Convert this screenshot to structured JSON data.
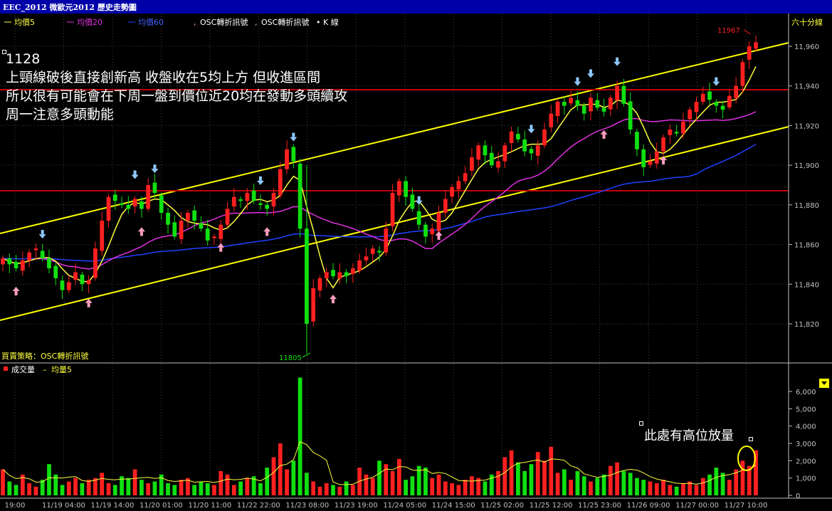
{
  "window": {
    "title": "EEC_2012 微歐元2012  歷史走勢圖"
  },
  "legend": {
    "ma5": "均價5",
    "ma20": "均價20",
    "ma60": "均價60",
    "osc1": "OSC轉折訊號",
    "osc2": "OSC轉折訊號",
    "kline": "K 線",
    "period": "六十分線",
    "strategy": "買賣策略：OSC轉折訊號",
    "volume": "成交量",
    "vol_ma": "均量5"
  },
  "annotations": {
    "date_label": "1128",
    "line1": "上頸線破後直接創新高 收盤收在5均上方 但收進區間",
    "line2": "所以很有可能會在下周一盤到價位近20均在發動多頭續攻",
    "line3": "周一注意多頭動能",
    "volume_note": "此處有高位放量",
    "high_label": "11967",
    "low_label": "11805"
  },
  "colors": {
    "up": "#ff2020",
    "down": "#10e010",
    "ma5": "#ffff40",
    "ma20": "#e030e0",
    "ma60": "#2040ff",
    "channel": "#ffff00",
    "neckline": "#c00000",
    "grid": "#404040",
    "buy_arrow": "#ff9ec0",
    "sell_arrow": "#8ec8ff"
  },
  "chart_data": [
    {
      "type": "candlestick",
      "title": "EEC_2012 微歐元2012 六十分線",
      "y_ticks": [
        "11,820",
        "11,840",
        "11,860",
        "11,880",
        "11,900",
        "11,920",
        "11,940",
        "11,960"
      ],
      "ylim": [
        11805,
        11975
      ],
      "x_ticks": [
        "19:00",
        "11/19 04:00",
        "11/19 14:00",
        "11/20 01:00",
        "11/20 11:00",
        "11/22 22:00",
        "11/23 08:00",
        "11/23 19:00",
        "11/24 05:00",
        "11/24 15:00",
        "11/25 02:00",
        "11/25 12:00",
        "11/25 23:00",
        "11/26 09:00",
        "11/27 00:00",
        "11/27 10:00"
      ],
      "close": [
        11853,
        11850,
        11848,
        11852,
        11856,
        11858,
        11853,
        11848,
        11843,
        11837,
        11841,
        11846,
        11840,
        11842,
        11858,
        11872,
        11884,
        11882,
        11880,
        11878,
        11883,
        11878,
        11890,
        11886,
        11876,
        11870,
        11864,
        11872,
        11876,
        11872,
        11868,
        11862,
        11864,
        11870,
        11878,
        11884,
        11882,
        11886,
        11882,
        11880,
        11878,
        11886,
        11898,
        11908,
        11902,
        11868,
        11820,
        11838,
        11843,
        11846,
        11844,
        11846,
        11844,
        11848,
        11852,
        11854,
        11858,
        11856,
        11868,
        11886,
        11892,
        11884,
        11878,
        11870,
        11864,
        11868,
        11876,
        11883,
        11889,
        11892,
        11896,
        11904,
        11910,
        11905,
        11900,
        11902,
        11910,
        11917,
        11913,
        11907,
        11906,
        11910,
        11918,
        11926,
        11932,
        11930,
        11934,
        11930,
        11926,
        11934,
        11929,
        11927,
        11934,
        11940,
        11931,
        11918,
        11908,
        11899,
        11902,
        11907,
        11914,
        11918,
        11916,
        11922,
        11928,
        11932,
        11936,
        11933,
        11930,
        11928,
        11935,
        11940,
        11952,
        11960,
        11962
      ],
      "volume": [
        1500,
        800,
        600,
        1200,
        700,
        500,
        900,
        1800,
        1200,
        600,
        800,
        1000,
        700,
        900,
        1000,
        1300,
        700,
        600,
        1100,
        1000,
        1500,
        900,
        700,
        800,
        1200,
        700,
        600,
        900,
        1000,
        600,
        800,
        700,
        600,
        1400,
        1200,
        600,
        800,
        1000,
        1100,
        700,
        1600,
        2200,
        3000,
        1500,
        2000,
        6800,
        1300,
        800,
        500,
        700,
        600,
        500,
        800,
        600,
        1600,
        1200,
        1000,
        2000,
        1800,
        1400,
        2100,
        900,
        1100,
        1700,
        1600,
        1000,
        1200,
        800,
        700,
        600,
        900,
        1100,
        1000,
        800,
        1200,
        1400,
        2200,
        2600,
        1900,
        1400,
        1800,
        2500,
        2000,
        2800,
        1300,
        1500,
        900,
        1400,
        1100,
        800,
        1000,
        1200,
        1700,
        1900,
        1400,
        1300,
        1000,
        900,
        800,
        700,
        900,
        600,
        500,
        700,
        800,
        600,
        1000,
        1200,
        1600,
        1300,
        900,
        1500,
        2000,
        1700,
        2600,
        1400
      ]
    }
  ]
}
